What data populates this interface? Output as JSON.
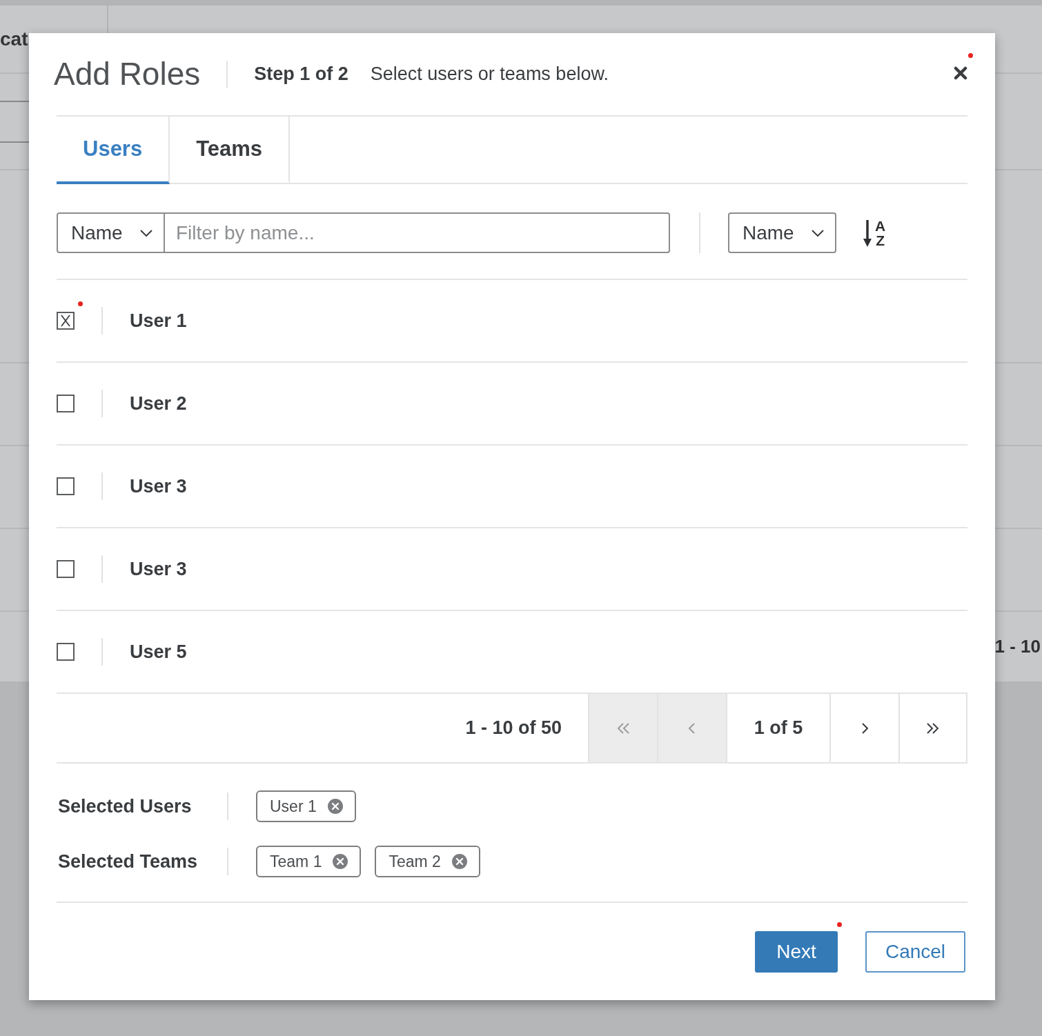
{
  "background": {
    "header_text": "cat",
    "footer_text": "1 - 10"
  },
  "dialog": {
    "title": "Add Roles",
    "step": "Step 1 of 2",
    "instruction": "Select users or teams below."
  },
  "tabs": [
    {
      "label": "Users",
      "selected": true
    },
    {
      "label": "Teams",
      "selected": false
    }
  ],
  "filter": {
    "field": "Name",
    "placeholder": "Filter by name..."
  },
  "sort": {
    "field": "Name",
    "from": "A",
    "to": "Z"
  },
  "list": [
    {
      "name": "User 1",
      "checked": true
    },
    {
      "name": "User 2",
      "checked": false
    },
    {
      "name": "User 3",
      "checked": false
    },
    {
      "name": "User 3",
      "checked": false
    },
    {
      "name": "User 5",
      "checked": false
    }
  ],
  "pagination": {
    "range": "1 - 10 of 50",
    "controls": [
      {
        "kind": "first",
        "disabled": true
      },
      {
        "kind": "previous",
        "disabled": true
      },
      {
        "kind": "page",
        "text": "1 of 5"
      },
      {
        "kind": "next",
        "disabled": false
      },
      {
        "kind": "last",
        "disabled": false
      }
    ]
  },
  "selected_users": {
    "label": "Selected Users",
    "tags": [
      "User 1"
    ]
  },
  "selected_teams": {
    "label": "Selected Teams",
    "tags": [
      "Team 1",
      "Team 2"
    ]
  },
  "footer": {
    "buttons": [
      {
        "label": "Next",
        "kind": "next"
      },
      {
        "label": "Cancel",
        "kind": "cancel"
      }
    ]
  }
}
